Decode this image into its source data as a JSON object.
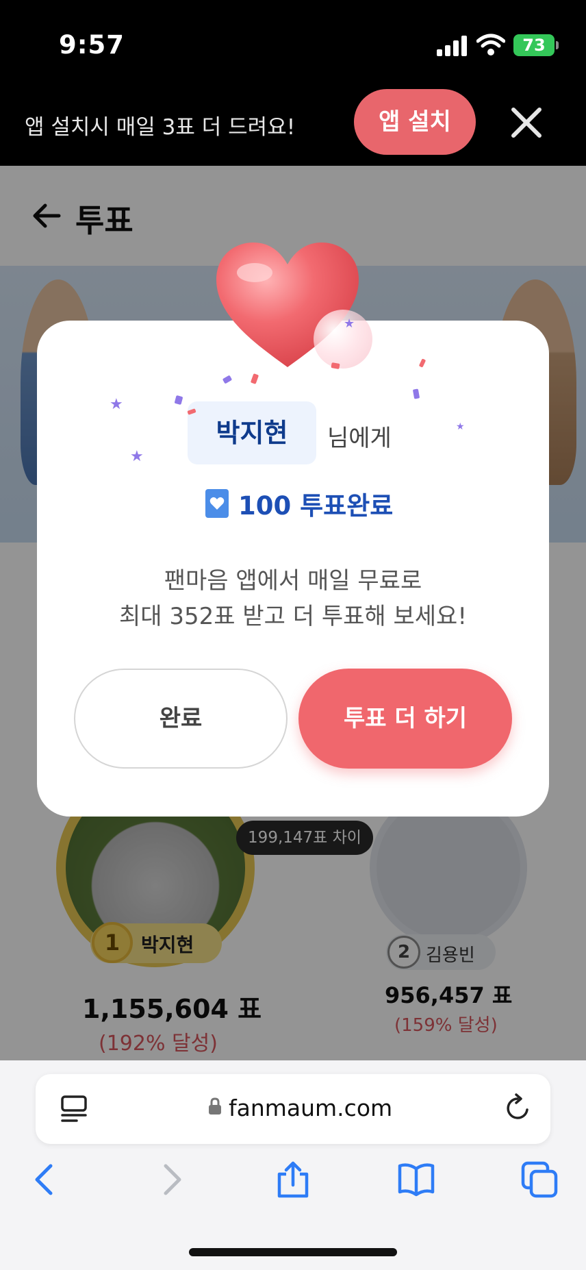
{
  "status_bar": {
    "time": "9:57",
    "battery": "73"
  },
  "app_banner": {
    "text": "앱 설치시 매일 3표 더 드려요!",
    "install_label": "앱 설치"
  },
  "page": {
    "title": "투표",
    "ranking": {
      "gap_text": "199,147표 차이",
      "first": {
        "rank": "1",
        "name": "박지현",
        "votes": "1,155,604 표",
        "percent": "(192% 달성)"
      },
      "second": {
        "rank": "2",
        "name": "김용빈",
        "votes": "956,457 표",
        "percent": "(159% 달성)"
      }
    }
  },
  "modal": {
    "recipient_name": "박지현",
    "recipient_suffix": "님에게",
    "vote_result": "100 투표완료",
    "message_line1": "팬마음 앱에서 매일 무료로",
    "message_line2": "최대 352표 받고 더 투표해 보세요!",
    "done_label": "완료",
    "more_label": "투표 더 하기"
  },
  "browser": {
    "url": "fanmaum.com"
  },
  "colors": {
    "accent": "#f0676d",
    "name_blue": "#0f3b8c",
    "vote_blue": "#1d4fb5",
    "gold": "#e9c954"
  }
}
